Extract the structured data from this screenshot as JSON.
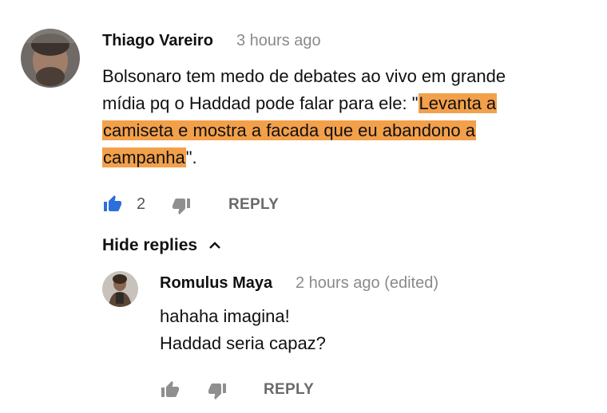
{
  "comment": {
    "author": "Thiago Vareiro",
    "time": "3 hours ago",
    "text_lines": [
      "Bolsonaro tem medo de debates ao vivo em grande",
      "mídia pq o Haddad pode falar para ele: \"",
      "Levanta a",
      "camiseta e mostra a facada que eu abandono a",
      "campanha",
      "\"."
    ],
    "like_count": "2",
    "reply_label": "REPLY"
  },
  "replies_toggle": {
    "label": "Hide replies"
  },
  "reply": {
    "author": "Romulus Maya",
    "time": "2 hours ago (edited)",
    "text_lines": [
      "hahaha imagina!",
      "Haddad seria capaz?"
    ],
    "reply_label": "REPLY"
  },
  "icons": {
    "like": "thumbs-up-icon",
    "dislike": "thumbs-down-icon",
    "chevron": "chevron-up-icon"
  },
  "colors": {
    "highlight": "#f3a04b",
    "like_active": "#2b6fdb",
    "icon_inactive": "#8f8f8f"
  }
}
